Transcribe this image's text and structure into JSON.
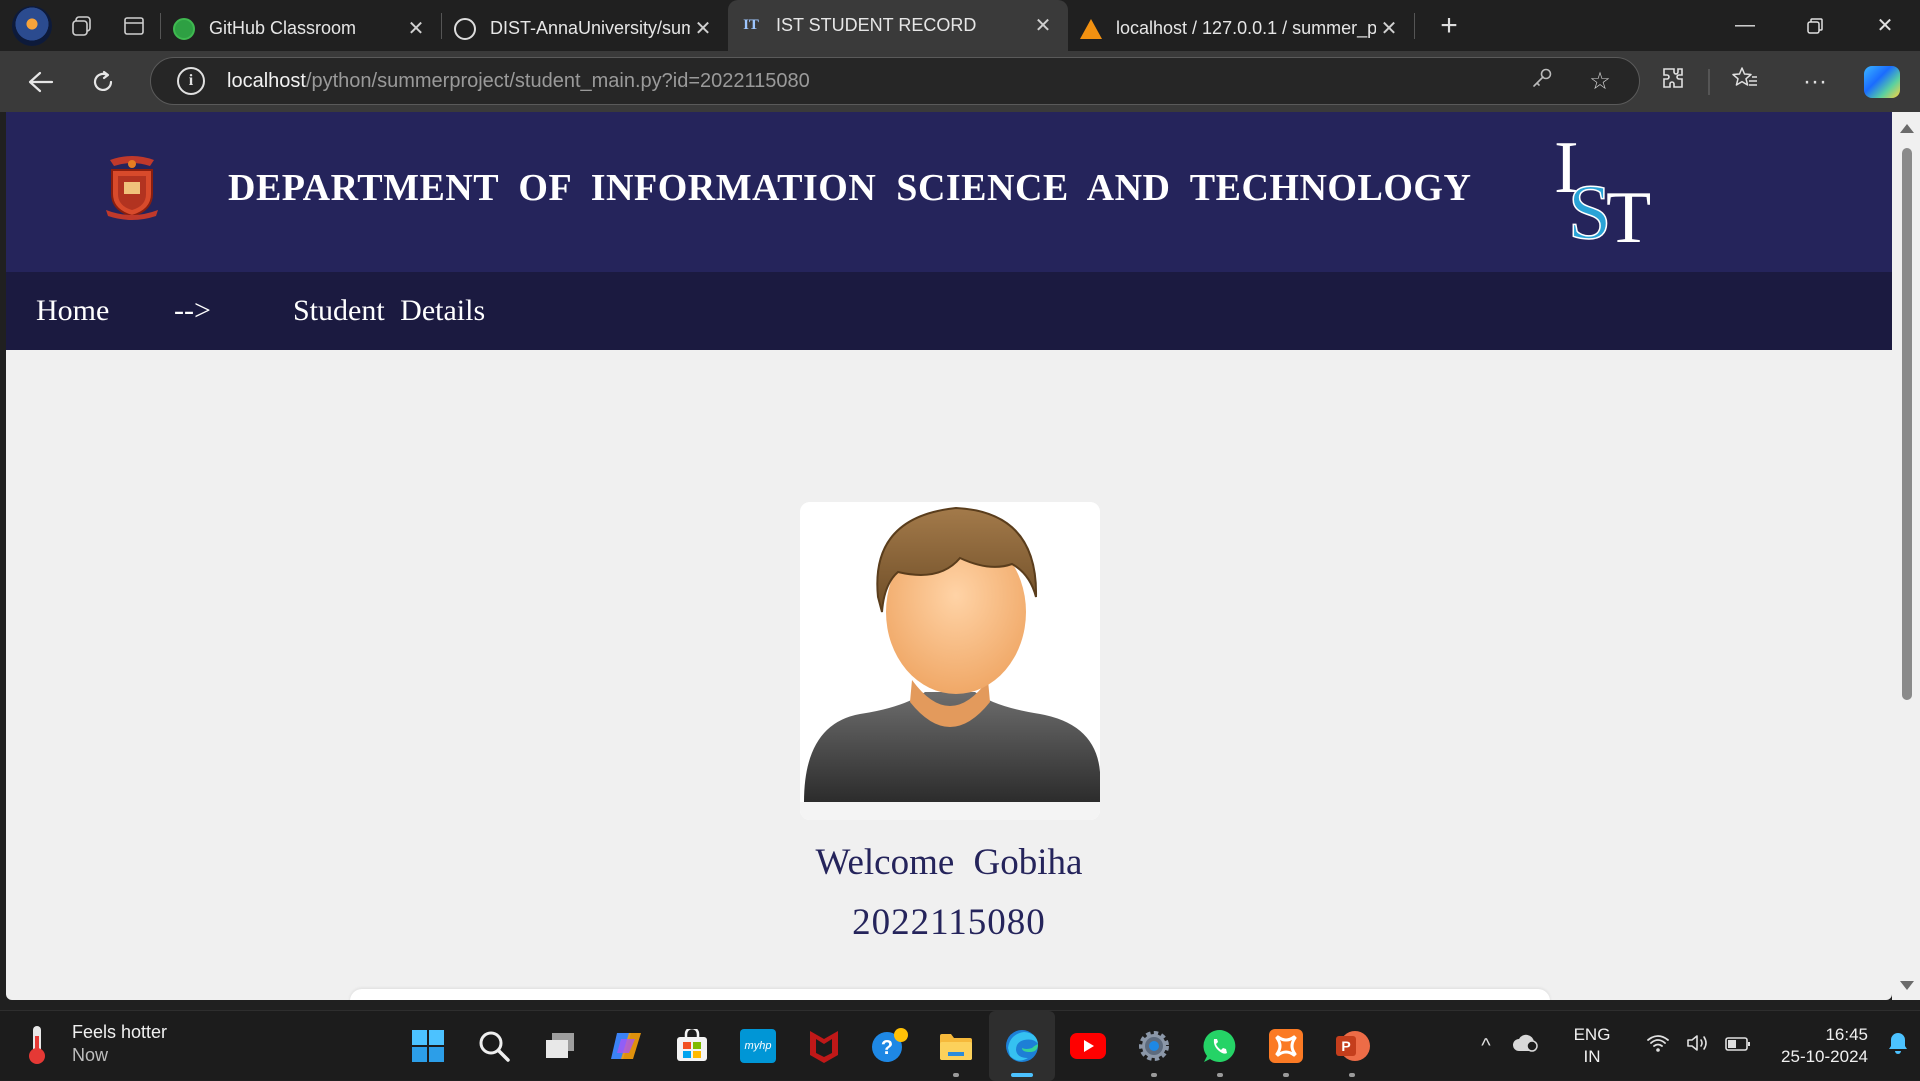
{
  "browser": {
    "tabs": [
      {
        "title": "GitHub Classroom",
        "icon": "github-icon",
        "active": false
      },
      {
        "title": "DIST-AnnaUniversity/summer-in",
        "icon": "github-icon",
        "active": false
      },
      {
        "title": "IST STUDENT RECORD",
        "icon": "ist-icon",
        "active": true
      },
      {
        "title": "localhost / 127.0.0.1 / summer_p",
        "icon": "phpmyadmin-icon",
        "active": false
      }
    ],
    "close_glyph": "✕",
    "newtab_glyph": "+",
    "url_host": "localhost",
    "url_path": "/python/summerproject/student_main.py?id=2022115080"
  },
  "site": {
    "title": "DEPARTMENT OF INFORMATION SCIENCE AND TECHNOLOGY",
    "logo_text": "IST",
    "header_color": "#25245b",
    "nav": {
      "home": "Home",
      "arrow": "-->",
      "current": "Student Details"
    }
  },
  "student": {
    "welcome_prefix": "Welcome",
    "name": "Gobiha",
    "reg_no": "2022115080"
  },
  "taskbar": {
    "weather_title": "Feels hotter",
    "weather_sub": "Now",
    "apps": [
      "start-icon",
      "search-icon",
      "task-view-icon",
      "copilot-icon",
      "store-icon",
      "myhp-icon",
      "mcafee-icon",
      "tips-icon",
      "file-explorer-icon",
      "edge-icon",
      "youtube-icon",
      "settings-icon",
      "whatsapp-icon",
      "xampp-icon",
      "powerpoint-icon"
    ],
    "myhp_label": "myhp",
    "lang_top": "ENG",
    "lang_bottom": "IN",
    "time": "16:45",
    "date": "25-10-2024"
  }
}
